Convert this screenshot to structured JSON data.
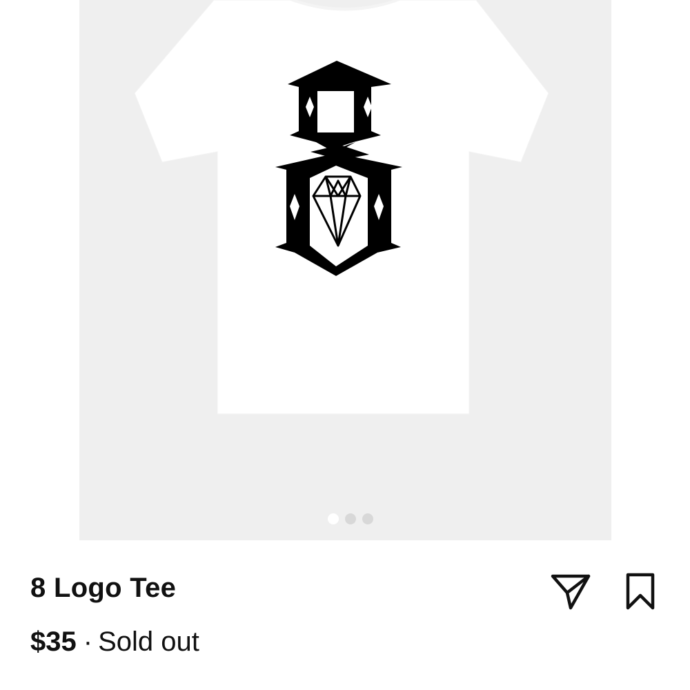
{
  "product": {
    "title": "8 Logo Tee",
    "price": "$35",
    "separator": "·",
    "status": "Sold out"
  },
  "gallery": {
    "image_count": 3,
    "active_index": 0,
    "background": "#efefef"
  },
  "actions": {
    "share_icon": "paper-plane-icon",
    "save_icon": "bookmark-icon"
  }
}
